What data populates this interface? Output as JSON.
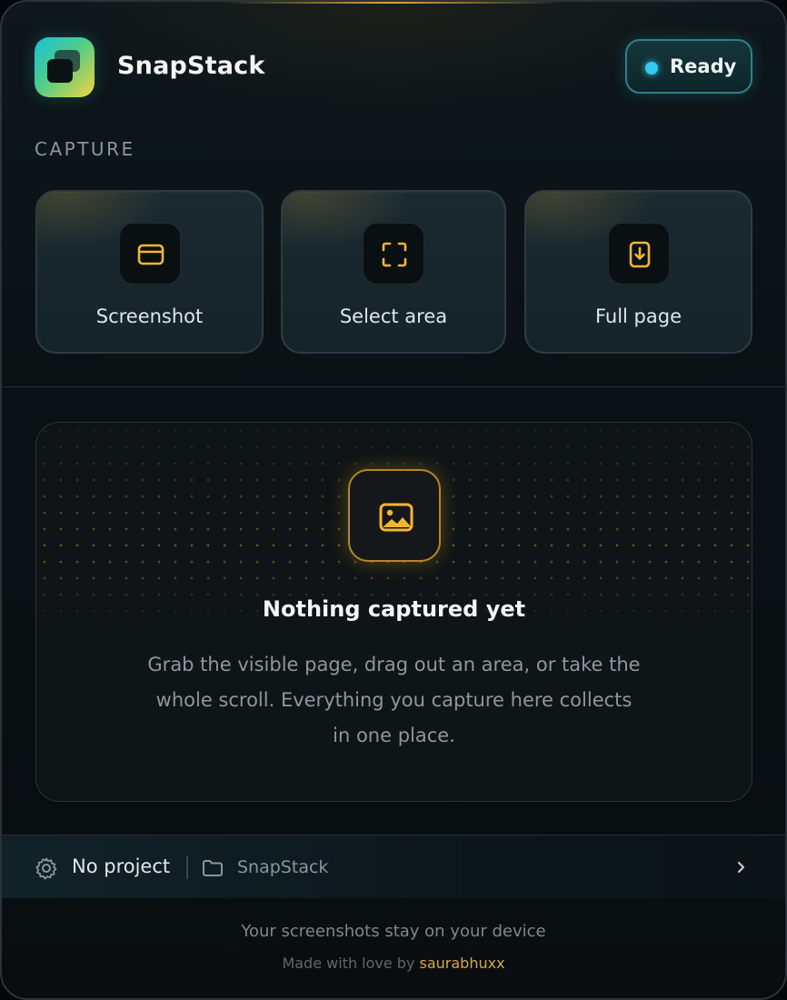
{
  "app": {
    "title": "SnapStack",
    "status": "Ready",
    "accent_color": "#f2b632",
    "status_color": "#35c9f0"
  },
  "capture": {
    "section_label": "CAPTURE",
    "actions": [
      {
        "label": "Screenshot",
        "icon": "window-icon"
      },
      {
        "label": "Select area",
        "icon": "select-area-icon"
      },
      {
        "label": "Full page",
        "icon": "full-page-download-icon"
      }
    ]
  },
  "empty_state": {
    "icon": "image-icon",
    "title": "Nothing captured yet",
    "description": "Grab the visible page, drag out an area, or take the whole scroll. Everything you capture here collects in one place."
  },
  "footer": {
    "project_label": "No project",
    "folder_label": "SnapStack",
    "privacy_note": "Your screenshots stay on your device",
    "made_with_prefix": "Made with love by",
    "author": "saurabhuxx"
  }
}
